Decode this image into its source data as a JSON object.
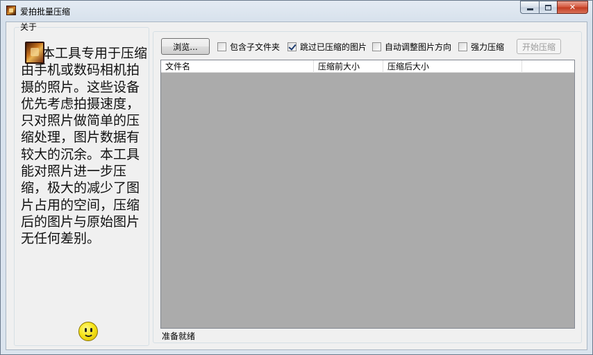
{
  "window": {
    "title": "爱拍批量压缩"
  },
  "about": {
    "title": "关于",
    "text": "本工具专用于压缩由手机或数码相机拍摄的照片。这些设备优先考虑拍摄速度，只对照片做简单的压缩处理，图片数据有较大的沉余。本工具能对照片进一步压缩，极大的减少了图片占用的空间，压缩后的图片与原始图片无任何差别。"
  },
  "toolbar": {
    "browse_label": "浏览...",
    "include_subfolders": {
      "label": "包含子文件夹",
      "checked": false
    },
    "skip_compressed": {
      "label": "跳过已压缩的图片",
      "checked": true
    },
    "auto_rotate": {
      "label": "自动调整图片方向",
      "checked": false
    },
    "force_compress": {
      "label": "强力压缩",
      "checked": false
    },
    "start_label": "开始压缩"
  },
  "list": {
    "columns": [
      "文件名",
      "压缩前大小",
      "压缩后大小",
      ""
    ]
  },
  "status": {
    "text": "准备就绪"
  }
}
